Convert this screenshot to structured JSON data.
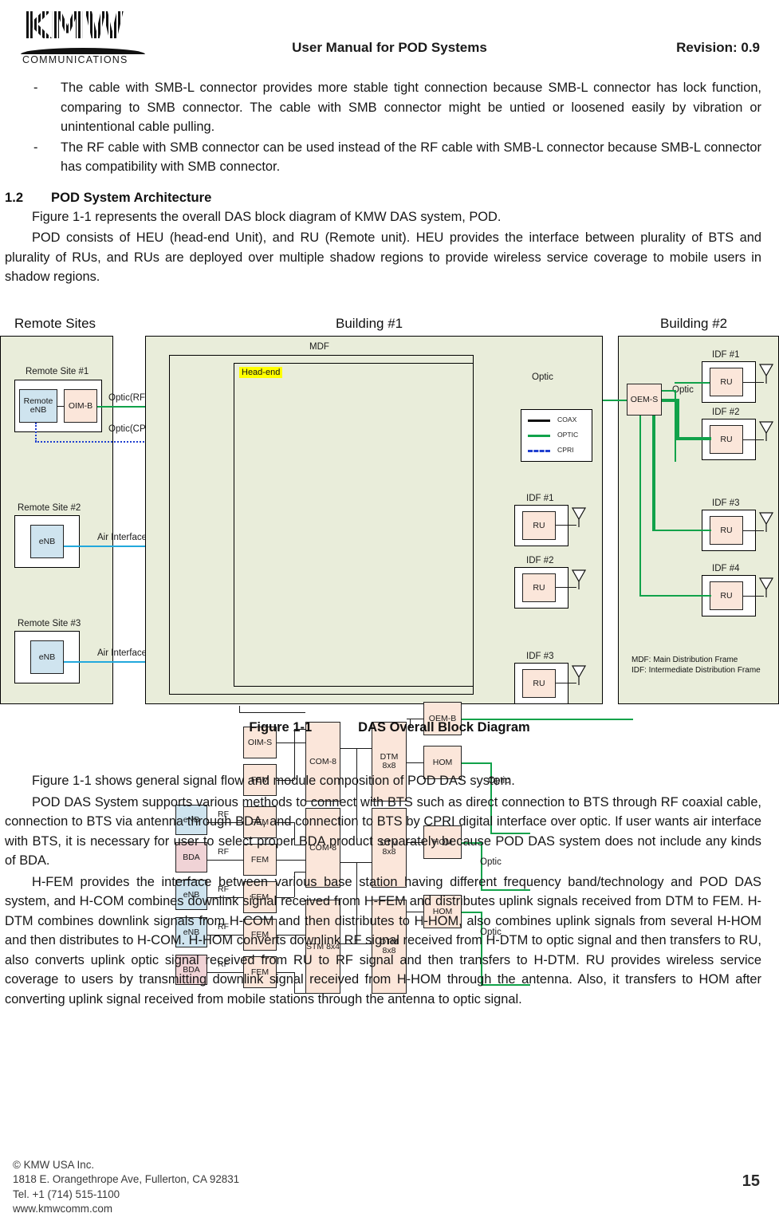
{
  "header": {
    "logo_text": "KMW",
    "logo_sub": "COMMUNICATIONS",
    "title": "User Manual for POD Systems",
    "revision": "Revision: 0.9"
  },
  "bullets": [
    {
      "dash": "-",
      "text": "The cable with SMB-L connector provides more stable tight connection because SMB-L connector has lock function, comparing to SMB connector. The cable with SMB connector might be untied or loosened easily by vibration or unintentional cable pulling."
    },
    {
      "dash": "-",
      "text": "The RF cable with SMB connector can be used instead of the RF cable with SMB-L connector because SMB-L connector has compatibility with SMB connector."
    }
  ],
  "section": {
    "number": "1.2",
    "title": "POD System Architecture",
    "para1": "Figure 1-1 represents the overall DAS block diagram of KMW DAS system, POD.",
    "para2": "POD consists of HEU (head-end Unit), and RU (Remote unit). HEU provides the interface between plurality of BTS and plurality of RUs, and RUs are deployed over multiple shadow regions to provide wireless service coverage to mobile users in shadow regions."
  },
  "figure": {
    "caption_number": "Figure 1-1",
    "caption_title": "DAS Overall Block Diagram",
    "group_labels": {
      "remote_sites": "Remote Sites",
      "building1": "Building #1",
      "building2": "Building #2"
    },
    "remote_sites": [
      {
        "label": "Remote Site #1",
        "nodes": [
          "Remote eNB",
          "OIM-B"
        ]
      },
      {
        "label": "Remote Site #2",
        "nodes": [
          "eNB"
        ]
      },
      {
        "label": "Remote Site #3",
        "nodes": [
          "eNB"
        ]
      }
    ],
    "links": {
      "optic_rf": "Optic(RF)",
      "optic_cpri": "Optic(CPRI)",
      "air_interface_1": "Air Interface",
      "air_interface_2": "Air Interface",
      "rf": "RF",
      "optic": "Optic"
    },
    "mdf": {
      "label": "MDF",
      "headend_label": "Head-end",
      "source_column": [
        "eNB",
        "BDA",
        "eNB",
        "eNB",
        "BDA"
      ],
      "interface_column": [
        "OIM-S",
        "FEM",
        "FEM",
        "FEM",
        "FEM",
        "FEM",
        "FEM"
      ],
      "com_column": [
        "COM-8",
        "COM-8",
        "STM 8x4"
      ],
      "dtm_column": [
        "DTM 8x8",
        "DTM 8x8",
        "DTM 8x8"
      ],
      "out_column": [
        "OEM-B",
        "HOM",
        "HOM",
        "HOM"
      ]
    },
    "legend": {
      "rows": [
        {
          "label": "COAX",
          "color": "#111111",
          "style": "solid"
        },
        {
          "label": "OPTIC",
          "color": "#11A24A",
          "style": "solid"
        },
        {
          "label": "CPRI",
          "color": "#1F3FCF",
          "style": "dashed"
        }
      ]
    },
    "building1_idfs": [
      {
        "label": "IDF #1",
        "node": "RU",
        "link": "Optic"
      },
      {
        "label": "IDF #2",
        "node": "RU",
        "link": "Optic"
      },
      {
        "label": "IDF #3",
        "node": "RU",
        "link": "Optic"
      }
    ],
    "building2": {
      "oem": "OEM-S",
      "link": "Optic",
      "idfs": [
        {
          "label": "IDF #1",
          "node": "RU"
        },
        {
          "label": "IDF #2",
          "node": "RU"
        },
        {
          "label": "IDF #3",
          "node": "RU"
        },
        {
          "label": "IDF #4",
          "node": "RU"
        }
      ],
      "notes": [
        "MDF: Main Distribution Frame",
        "IDF: Intermediate Distribution Frame"
      ]
    }
  },
  "body": {
    "para3": "Figure 1-1 shows general signal flow and module composition of POD DAS system.",
    "para4": "POD DAS System supports various methods to connect with BTS such as direct connection to BTS through RF coaxial cable, connection to BTS via antenna through BDA, and connection to BTS by CPRI digital interface over optic. If user wants air interface with BTS, it is necessary for user to select proper BDA product separately because POD DAS system does not include any kinds of BDA.",
    "para5": "H-FEM provides the interface between various base station having different frequency band/technology and POD DAS system, and H-COM combines downlink signal received from H-FEM and distributes uplink signals received from DTM to FEM. H-DTM combines downlink signals from H-COM and then distributes to H-HOM, also combines uplink signals from several H-HOM and then distributes to H-COM. H-HOM converts downlink RF signal received from H-DTM to optic signal and then transfers to RU, also converts uplink optic signal received from RU to RF signal and then transfers to H-DTM. RU provides wireless service coverage to users by transmitting downlink signal received from H-HOM through the antenna. Also, it transfers to HOM after converting uplink signal received from mobile stations through the antenna to optic signal."
  },
  "footer": {
    "line1": "© KMW USA Inc.",
    "line2": "1818 E. Orangethrope Ave, Fullerton, CA 92831",
    "line3": "Tel. +1 (714) 515-1100",
    "line4": "www.kmwcomm.com",
    "page_number": "15"
  }
}
